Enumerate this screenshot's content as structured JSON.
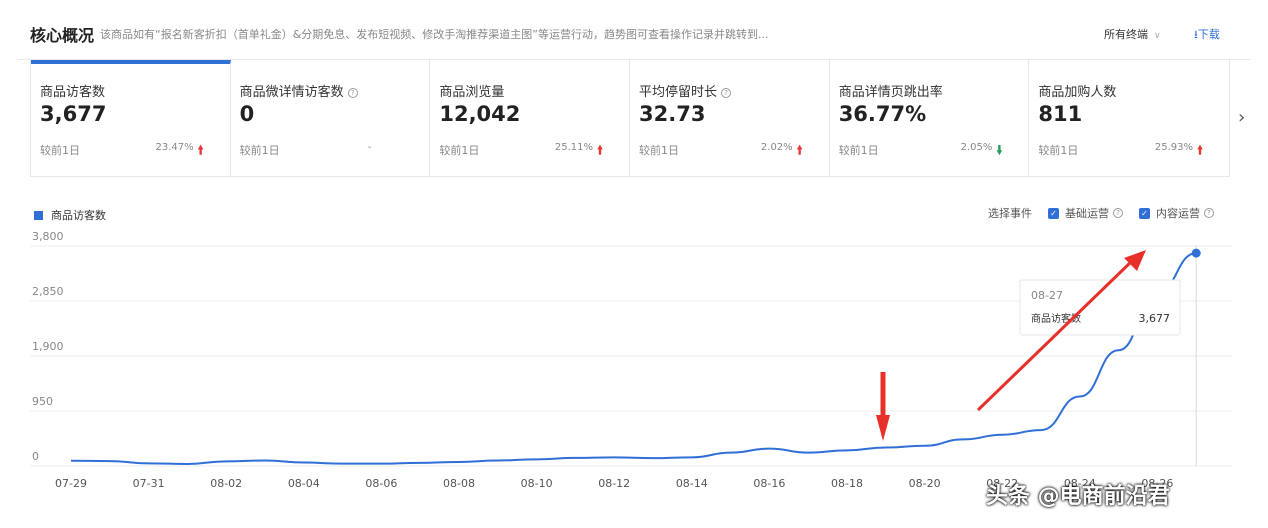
{
  "header": {
    "title": "核心概况",
    "subtitle": "该商品如有“报名新客折扣（首单礼金）&分期免息、发布短视频、修改手淘推荐渠道主图”等运营行动，趋势图可查看操作记录并跳转到...",
    "terminal": "所有终端",
    "download": "下载"
  },
  "metrics": [
    {
      "label": "商品访客数",
      "value": "3,677",
      "compare": "较前1日",
      "change": "23.47%",
      "trend": "up",
      "help": false
    },
    {
      "label": "商品微详情访客数",
      "value": "0",
      "compare": "较前1日",
      "change": "-",
      "trend": "none",
      "help": true
    },
    {
      "label": "商品浏览量",
      "value": "12,042",
      "compare": "较前1日",
      "change": "25.11%",
      "trend": "up",
      "help": false
    },
    {
      "label": "平均停留时长",
      "value": "32.73",
      "compare": "较前1日",
      "change": "2.02%",
      "trend": "up",
      "help": true
    },
    {
      "label": "商品详情页跳出率",
      "value": "36.77%",
      "compare": "较前1日",
      "change": "2.05%",
      "trend": "down",
      "help": false
    },
    {
      "label": "商品加购人数",
      "value": "811",
      "compare": "较前1日",
      "change": "25.93%",
      "trend": "up",
      "help": false
    }
  ],
  "chart_controls": {
    "legend": "商品访客数",
    "select_event": "选择事件",
    "event1": "基础运营",
    "event2": "内容运营"
  },
  "tooltip": {
    "date": "08-27",
    "label": "商品访客数",
    "value": "3,677"
  },
  "watermark": "头条 @电商前沿君",
  "colors": {
    "accent": "#2f6fd6",
    "up": "#e8383a",
    "down": "#22a05a",
    "annotation": "#e8302a"
  },
  "chart_data": {
    "type": "line",
    "yticks": [
      "3,800",
      "2,850",
      "1,900",
      "950",
      "0"
    ],
    "ylim": [
      0,
      3800
    ],
    "xticks": [
      "07-29",
      "07-31",
      "08-02",
      "08-04",
      "08-06",
      "08-08",
      "08-10",
      "08-12",
      "08-14",
      "08-16",
      "08-18",
      "08-20",
      "08-22",
      "08-24",
      "08-26"
    ],
    "x": [
      "07-29",
      "07-30",
      "07-31",
      "08-01",
      "08-02",
      "08-03",
      "08-04",
      "08-05",
      "08-06",
      "08-07",
      "08-08",
      "08-09",
      "08-10",
      "08-11",
      "08-12",
      "08-13",
      "08-14",
      "08-15",
      "08-16",
      "08-17",
      "08-18",
      "08-19",
      "08-20",
      "08-21",
      "08-22",
      "08-23",
      "08-24",
      "08-25",
      "08-26",
      "08-27"
    ],
    "series": [
      {
        "name": "商品访客数",
        "values": [
          90,
          85,
          45,
          35,
          80,
          95,
          60,
          40,
          40,
          55,
          70,
          95,
          115,
          140,
          150,
          135,
          150,
          230,
          300,
          230,
          270,
          320,
          350,
          460,
          540,
          620,
          1200,
          2000,
          3000,
          3677
        ]
      }
    ]
  }
}
